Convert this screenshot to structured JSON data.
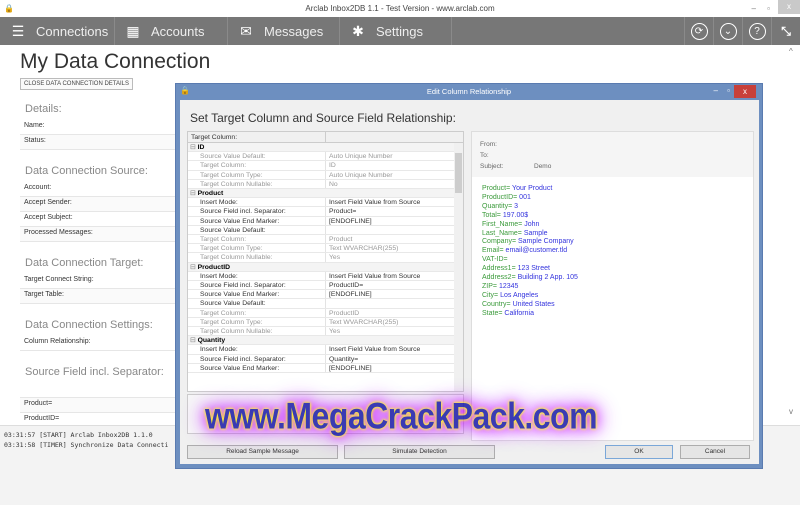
{
  "window": {
    "title": "Arclab Inbox2DB 1.1 - Test Version - www.arclab.com",
    "minimize": "–",
    "maximize": "▫",
    "close": "x"
  },
  "nav": {
    "items": [
      {
        "label": "Connections",
        "icon": "database-icon",
        "glyph": "☰"
      },
      {
        "label": "Accounts",
        "icon": "address-book-icon",
        "glyph": "▦"
      },
      {
        "label": "Messages",
        "icon": "envelope-icon",
        "glyph": "✉"
      },
      {
        "label": "Settings",
        "icon": "gear-icon",
        "glyph": "✱"
      }
    ],
    "right": [
      {
        "icon": "refresh-icon",
        "glyph": "⟳"
      },
      {
        "icon": "chevron-down-icon",
        "glyph": "⌄"
      },
      {
        "icon": "help-icon",
        "glyph": "?"
      },
      {
        "icon": "collapse-icon",
        "glyph": "⤡"
      }
    ]
  },
  "page": {
    "title": "My Data Connection",
    "close_button": "CLOSE DATA CONNECTION DETAILS",
    "sections": [
      {
        "title": "Details:",
        "labels": [
          "Name:",
          "Status:"
        ]
      },
      {
        "title": "Data Connection Source:",
        "labels": [
          "Account:",
          "Accept Sender:",
          "Accept Subject:",
          "Processed Messages:"
        ]
      },
      {
        "title": "Data Connection Target:",
        "labels": [
          "Target Connect String:",
          "Target Table:"
        ]
      },
      {
        "title": "Data Connection Settings:",
        "labels": [
          "Column Relationship:"
        ]
      },
      {
        "title": "Source Field incl. Separator:",
        "labels": [
          "",
          "Product=",
          "ProductID="
        ]
      }
    ]
  },
  "log": [
    "03:31:57 [START] Arclab Inbox2DB 1.1.0",
    "03:31:58 [TIMER] Synchronize Data Connecti"
  ],
  "dialog": {
    "title": "Edit Column Relationship",
    "heading": "Set Target Column and Source Field Relationship:",
    "grid_header": "Target Column:",
    "groups": [
      {
        "name": "ID",
        "rows": [
          [
            "Source Value Default:",
            "Auto Unique Number",
            1
          ],
          [
            "Target Column:",
            "ID",
            1
          ],
          [
            "Target Column Type:",
            "Auto Unique Number",
            1
          ],
          [
            "Target Column Nullable:",
            "No",
            1
          ]
        ]
      },
      {
        "name": "Product",
        "rows": [
          [
            "Insert Mode:",
            "Insert Field Value from Source",
            0
          ],
          [
            "Source Field incl. Separator:",
            "Product=",
            0
          ],
          [
            "Source Value End Marker:",
            "[ENDOFLINE]",
            0
          ],
          [
            "Source Value Default:",
            "",
            0
          ],
          [
            "Target Column:",
            "Product",
            1
          ],
          [
            "Target Column Type:",
            "Text WVARCHAR(255)",
            1
          ],
          [
            "Target Column Nullable:",
            "Yes",
            1
          ]
        ]
      },
      {
        "name": "ProductID",
        "rows": [
          [
            "Insert Mode:",
            "Insert Field Value from Source",
            0
          ],
          [
            "Source Field incl. Separator:",
            "ProductID=",
            0
          ],
          [
            "Source Value End Marker:",
            "[ENDOFLINE]",
            0
          ],
          [
            "Source Value Default:",
            "",
            0
          ],
          [
            "Target Column:",
            "ProductID",
            1
          ],
          [
            "Target Column Type:",
            "Text WVARCHAR(255)",
            1
          ],
          [
            "Target Column Nullable:",
            "Yes",
            1
          ]
        ]
      },
      {
        "name": "Quantity",
        "rows": [
          [
            "Insert Mode:",
            "Insert Field Value from Source",
            0
          ],
          [
            "Source Field incl. Separator:",
            "Quantity=",
            0
          ],
          [
            "Source Value End Marker:",
            "[ENDOFLINE]",
            0
          ]
        ]
      }
    ],
    "mail": {
      "from_label": "From:",
      "to_label": "To:",
      "subject_label": "Subject:",
      "subject": "Demo",
      "lines": [
        [
          "Product=",
          "Your Product"
        ],
        [
          "ProductID=",
          "001"
        ],
        [
          "Quantity=",
          "3"
        ],
        [
          "Total=",
          "197.00$"
        ],
        [
          "First_Name=",
          "John"
        ],
        [
          "Last_Name=",
          "Sample"
        ],
        [
          "Company=",
          "Sample Company"
        ],
        [
          "Email=",
          "email@customer.tld"
        ],
        [
          "VAT-ID=",
          ""
        ],
        [
          "Address1=",
          "123 Street"
        ],
        [
          "Address2=",
          "Building 2 App. 105"
        ],
        [
          "ZIP=",
          "12345"
        ],
        [
          "City=",
          "Los Angeles"
        ],
        [
          "Country=",
          "United States"
        ],
        [
          "State=",
          "California"
        ]
      ]
    },
    "buttons": {
      "reload": "Reload Sample Message",
      "simulate": "Simulate Detection",
      "ok": "OK",
      "cancel": "Cancel"
    }
  },
  "watermark": "www.MegaCrackPack.com",
  "colors": {
    "nav": "#777777",
    "dialog_frame": "#6d8fc0",
    "mail_key": "#3a9a3a",
    "mail_value": "#3333dd",
    "close": "#c8403a"
  }
}
